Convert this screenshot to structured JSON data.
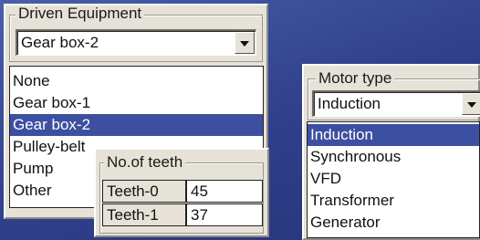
{
  "driven_equipment": {
    "group_label": "Driven Equipment",
    "selected_value": "Gear box-2",
    "options": [
      "None",
      "Gear box-1",
      "Gear box-2",
      "Pulley-belt",
      "Pump",
      "Other"
    ],
    "selected_index": 2
  },
  "teeth": {
    "group_label": "No.of teeth",
    "rows": [
      {
        "label": "Teeth-0",
        "value": "45"
      },
      {
        "label": "Teeth-1",
        "value": "37"
      }
    ]
  },
  "motor_type": {
    "group_label": "Motor type",
    "selected_value": "Induction",
    "options": [
      "Induction",
      "Synchronous",
      "VFD",
      "Transformer",
      "Generator"
    ],
    "selected_index": 0
  },
  "colors": {
    "background": "#2f3f8a",
    "panel": "#e6e2d8",
    "selection": "#3d4fa0"
  }
}
